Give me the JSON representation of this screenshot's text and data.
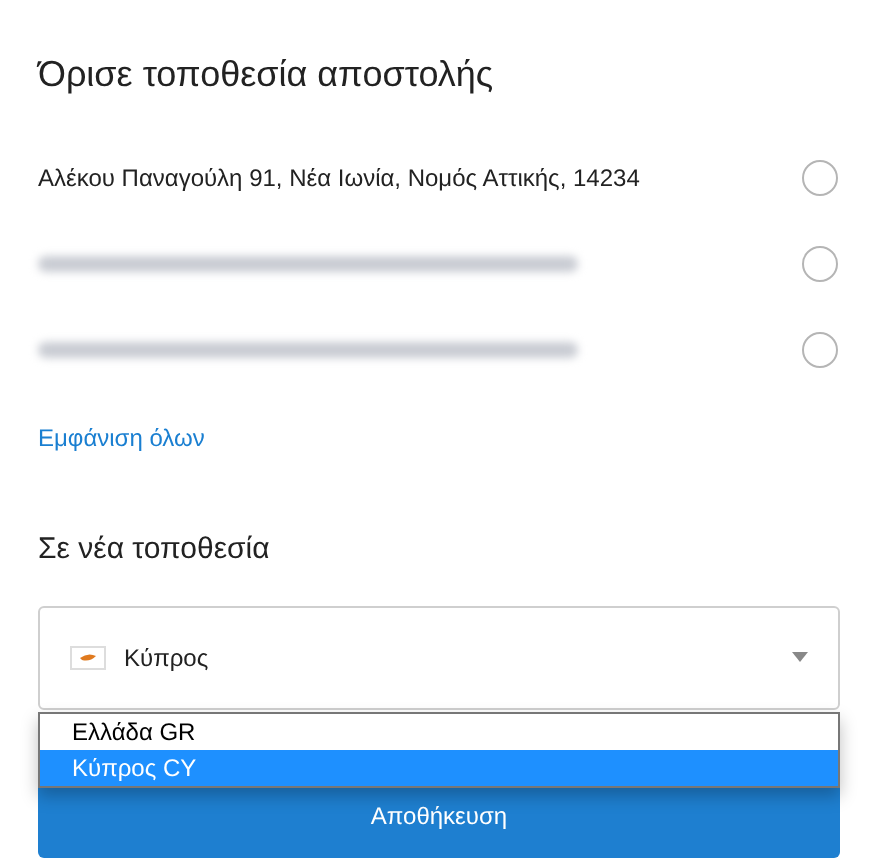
{
  "title": "Όρισε τοποθεσία αποστολής",
  "addresses": [
    {
      "kind": "text",
      "text": "Αλέκου Παναγούλη 91, Νέα Ιωνία, Νομός Αττικής, 14234",
      "selected": false
    },
    {
      "kind": "redacted",
      "selected": false
    },
    {
      "kind": "redacted",
      "selected": false
    }
  ],
  "show_all_link": "Εμφάνιση όλων",
  "new_location": {
    "heading": "Σε νέα τοποθεσία",
    "country_select": {
      "value": "Κύπρος",
      "expanded": true,
      "options": [
        {
          "label": "Ελλάδα GR",
          "selected": false
        },
        {
          "label": "Κύπρος CY",
          "selected": true
        }
      ]
    }
  },
  "save_button": "Αποθήκευση"
}
